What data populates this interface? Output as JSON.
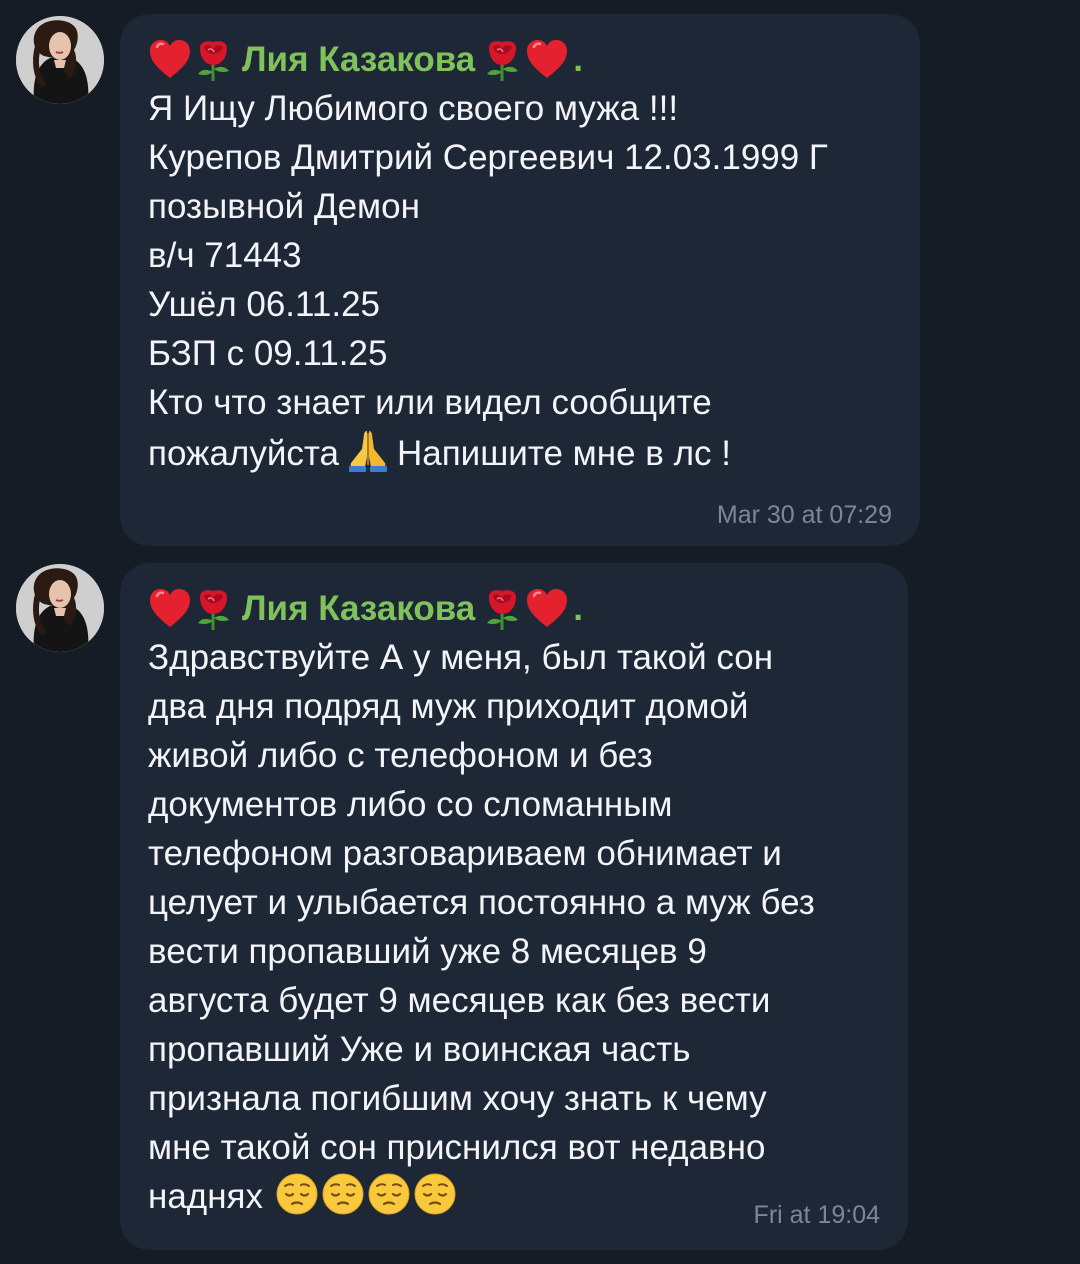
{
  "messages": [
    {
      "sender_name": "Лия Казакова",
      "sender_suffix": ".",
      "lines": [
        "Я Ищу Любимого своего мужа !!!",
        "Курепов Дмитрий Сергеевич 12.03.1999 Г",
        "позывной Демон",
        "в/ч 71443",
        "Ушёл 06.11.25",
        "БЗП с 09.11.25",
        "Кто что знает или видел сообщите"
      ],
      "last_line_before_emoji": "пожалуйста",
      "last_line_after_emoji": "Напишите мне в лс !",
      "time": "Mar 30 at 07:29"
    },
    {
      "sender_name": "Лия Казакова",
      "sender_suffix": ".",
      "lines": [
        "Здравствуйте А у меня, был такой сон",
        "два дня подряд муж приходит домой",
        "живой либо с телефоном и без",
        "документов либо со сломанным",
        "телефоном разговариваем обнимает и",
        "целует и улыбается постоянно а муж без",
        "вести пропавший уже 8 месяцев 9",
        "августа будет 9 месяцев как без вести",
        "пропавший Уже и воинская часть",
        "признала погибшим хочу знать к чему",
        "мне такой сон приснился вот недавно"
      ],
      "last_line": "наднях",
      "time": "Fri at 19:04"
    }
  ],
  "icons": {
    "heart": "heart-emoji",
    "rose": "rose-emoji",
    "pray": "folded-hands-emoji",
    "pensive": "pensive-face-emoji"
  },
  "colors": {
    "background": "#151c26",
    "bubble": "#1e2735",
    "sender_name": "#7fc15a",
    "text": "#f2f4f7",
    "timestamp": "#7d8794"
  }
}
